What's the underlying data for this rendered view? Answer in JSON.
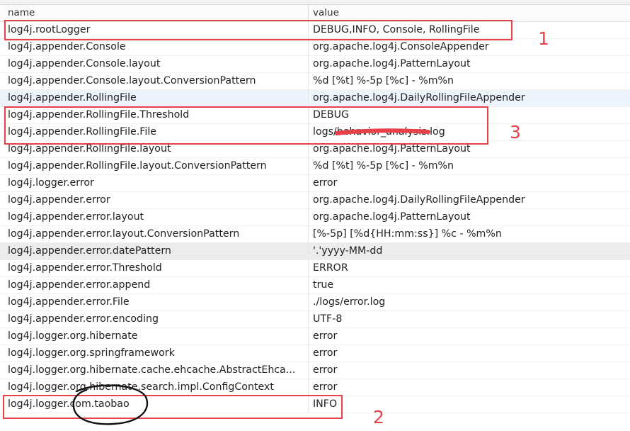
{
  "columns": {
    "name": "name",
    "value": "value"
  },
  "rows": [
    {
      "name": "log4j.rootLogger",
      "value": "DEBUG,INFO, Console, RollingFile"
    },
    {
      "name": "log4j.appender.Console",
      "value": "org.apache.log4j.ConsoleAppender"
    },
    {
      "name": "log4j.appender.Console.layout",
      "value": "org.apache.log4j.PatternLayout"
    },
    {
      "name": "log4j.appender.Console.layout.ConversionPattern",
      "value": "%d [%t] %-5p [%c] - %m%n"
    },
    {
      "name": "log4j.appender.RollingFile",
      "value": "org.apache.log4j.DailyRollingFileAppender"
    },
    {
      "name": "log4j.appender.RollingFile.Threshold",
      "value": "DEBUG"
    },
    {
      "name": "log4j.appender.RollingFile.File",
      "value": "logs/behavior_analysis.log"
    },
    {
      "name": "log4j.appender.RollingFile.layout",
      "value": "org.apache.log4j.PatternLayout"
    },
    {
      "name": "log4j.appender.RollingFile.layout.ConversionPattern",
      "value": "%d [%t] %-5p [%c] - %m%n"
    },
    {
      "name": "log4j.logger.error",
      "value": "error"
    },
    {
      "name": "log4j.appender.error",
      "value": "org.apache.log4j.DailyRollingFileAppender"
    },
    {
      "name": "log4j.appender.error.layout",
      "value": "org.apache.log4j.PatternLayout"
    },
    {
      "name": "log4j.appender.error.layout.ConversionPattern",
      "value": "[%-5p] [%d{HH:mm:ss}] %c - %m%n"
    },
    {
      "name": "log4j.appender.error.datePattern",
      "value": "'.'yyyy-MM-dd"
    },
    {
      "name": "log4j.appender.error.Threshold",
      "value": "ERROR"
    },
    {
      "name": "log4j.appender.error.append",
      "value": "true"
    },
    {
      "name": "log4j.appender.error.File",
      "value": "./logs/error.log"
    },
    {
      "name": "log4j.appender.error.encoding",
      "value": "UTF-8"
    },
    {
      "name": "log4j.logger.org.hibernate",
      "value": "error"
    },
    {
      "name": "log4j.logger.org.springframework",
      "value": "error"
    },
    {
      "name": "log4j.logger.org.hibernate.cache.ehcache.AbstractEhca...",
      "value": "error"
    },
    {
      "name": "log4j.logger.org.hibernate.search.impl.ConfigContext",
      "value": "error"
    },
    {
      "name": "log4j.logger.com.taobao",
      "value": "INFO"
    }
  ],
  "annotations": {
    "label1": "1",
    "label2": "2",
    "label3": "3"
  },
  "colors": {
    "annotation": "#e8414a",
    "alt_row": "#eef4fb",
    "selected_row": "#ececec"
  }
}
